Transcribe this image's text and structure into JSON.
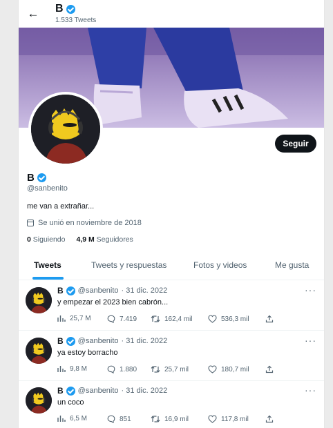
{
  "header": {
    "name": "B",
    "tweet_count": "1.533 Tweets"
  },
  "profile": {
    "name": "B",
    "handle": "@sanbenito",
    "bio": "me van a extrañar...",
    "joined": "Se unió en noviembre de 2018",
    "following_count": "0",
    "following_label": "Siguiendo",
    "followers_count": "4,9 M",
    "followers_label": "Seguidores",
    "follow_button": "Seguir"
  },
  "tabs": [
    {
      "label": "Tweets",
      "active": true
    },
    {
      "label": "Tweets y respuestas",
      "active": false
    },
    {
      "label": "Fotos y videos",
      "active": false
    },
    {
      "label": "Me gusta",
      "active": false
    }
  ],
  "tweets": [
    {
      "name": "B",
      "handle": "@sanbenito",
      "date": "· 31 dic. 2022",
      "text": "y empezar el 2023 bien cabrón...",
      "views": "25,7 M",
      "replies": "7.419",
      "retweets": "162,4 mil",
      "likes": "536,3 mil"
    },
    {
      "name": "B",
      "handle": "@sanbenito",
      "date": "· 31 dic. 2022",
      "text": "ya estoy borracho",
      "views": "9,8 M",
      "replies": "1.880",
      "retweets": "25,7 mil",
      "likes": "180,7 mil"
    },
    {
      "name": "B",
      "handle": "@sanbenito",
      "date": "· 31 dic. 2022",
      "text": "un coco",
      "views": "6,5 M",
      "replies": "851",
      "retweets": "16,9 mil",
      "likes": "117,8 mil"
    }
  ],
  "icons": {
    "back": "arrow-left-icon",
    "verified": "verified-badge-icon",
    "calendar": "calendar-icon",
    "more": "more-icon",
    "views": "views-icon",
    "reply": "reply-icon",
    "retweet": "retweet-icon",
    "like": "like-icon",
    "share": "share-icon"
  },
  "colors": {
    "accent": "#1d9bf0",
    "text": "#0f1419",
    "muted": "#536471",
    "button": "#0f1419"
  }
}
